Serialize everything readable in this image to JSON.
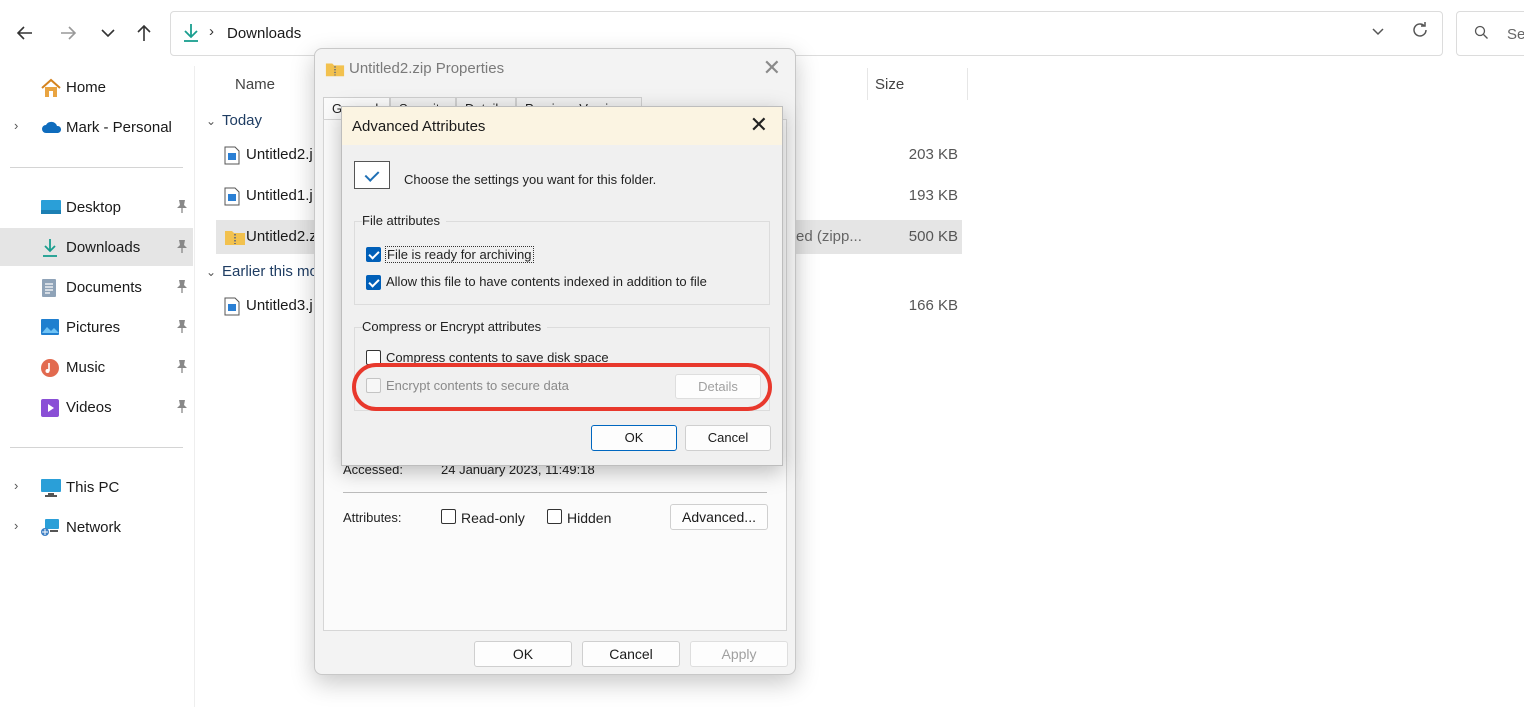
{
  "topbar": {
    "back_icon": "back-arrow-icon",
    "forward_icon": "forward-arrow-icon",
    "recent_icon": "chevron-down-icon",
    "up_icon": "up-arrow-icon",
    "address_path": "Downloads",
    "search_placeholder": "Se"
  },
  "sidebar": {
    "items": [
      {
        "label": "Home",
        "icon": "home-icon"
      },
      {
        "label": "Mark - Personal",
        "icon": "onedrive-cloud-icon"
      },
      {
        "label": "Desktop",
        "icon": "desktop-icon"
      },
      {
        "label": "Downloads",
        "icon": "download-icon"
      },
      {
        "label": "Documents",
        "icon": "documents-icon"
      },
      {
        "label": "Pictures",
        "icon": "pictures-icon"
      },
      {
        "label": "Music",
        "icon": "music-icon"
      },
      {
        "label": "Videos",
        "icon": "videos-icon"
      },
      {
        "label": "This PC",
        "icon": "computer-icon"
      },
      {
        "label": "Network",
        "icon": "network-icon"
      }
    ]
  },
  "list": {
    "col_name": "Name",
    "col_size": "Size",
    "groups": [
      {
        "label": "Today"
      },
      {
        "label": "Earlier this mo"
      }
    ],
    "rows": [
      {
        "name": "Untitled2.j",
        "type": "",
        "size": "203 KB"
      },
      {
        "name": "Untitled1.j",
        "type": "",
        "size": "193 KB"
      },
      {
        "name": "Untitled2.z",
        "type": "ed (zipp...",
        "size": "500 KB"
      },
      {
        "name": "Untitled3.j",
        "type": "",
        "size": "166 KB"
      }
    ]
  },
  "props": {
    "title": "Untitled2.zip Properties",
    "tabs": [
      "General",
      "Security",
      "Details",
      "Previous Versions"
    ],
    "accessed_label": "Accessed:",
    "accessed_value": "24 January 2023, 11:49:18",
    "attributes_label": "Attributes:",
    "readonly_label": "Read-only",
    "hidden_label": "Hidden",
    "advanced_button": "Advanced...",
    "ok": "OK",
    "cancel": "Cancel",
    "apply": "Apply"
  },
  "adv": {
    "title": "Advanced Attributes",
    "intro": "Choose the settings you want for this folder.",
    "file_attributes_legend": "File attributes",
    "archive_label": "File is ready for archiving",
    "archive_checked": true,
    "index_label": "Allow this file to have contents indexed in addition to file",
    "index_checked": true,
    "compress_legend": "Compress or Encrypt attributes",
    "compress_label": "Compress contents to save disk space",
    "compress_checked": false,
    "encrypt_label": "Encrypt contents to secure data",
    "encrypt_checked": false,
    "details_button": "Details",
    "ok": "OK",
    "cancel": "Cancel"
  },
  "colors": {
    "highlight_ring": "#e8382c",
    "accent": "#005fb8",
    "selection": "#e5e5e5"
  }
}
